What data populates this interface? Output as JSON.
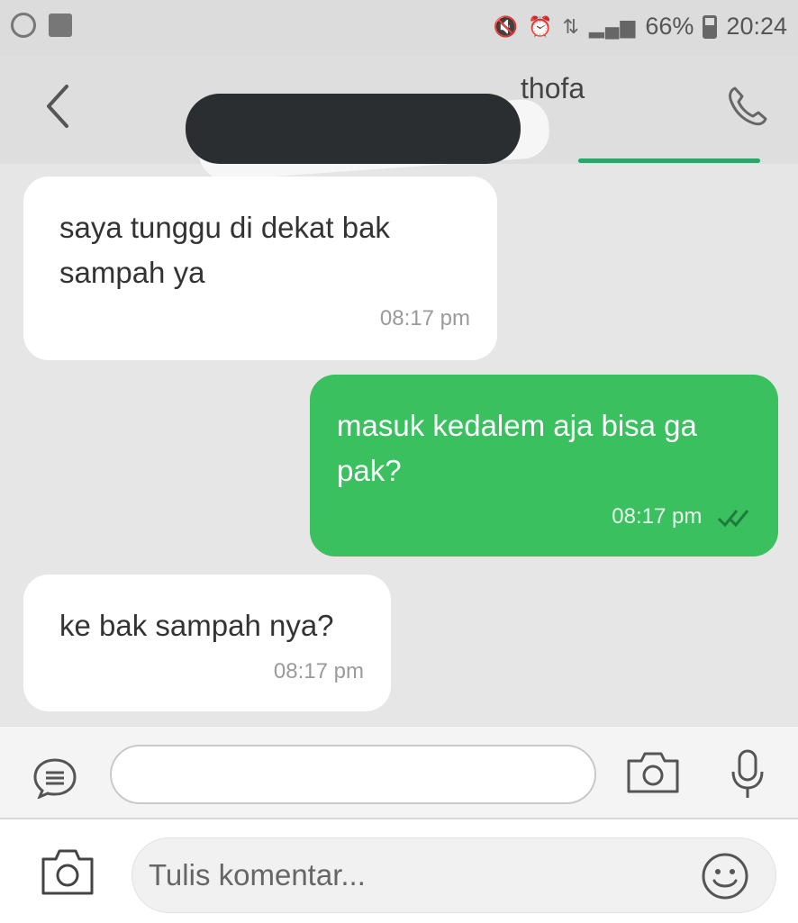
{
  "status_bar": {
    "left_icons": [
      "whatsapp-icon",
      "message-icon"
    ],
    "right_icons": [
      "mute-icon",
      "alarm-icon",
      "network-icon",
      "signal-icon",
      "battery-icon"
    ],
    "battery": "66%",
    "time": "20:24"
  },
  "header": {
    "contact_name_visible": "thofa",
    "back_icon": "chevron-left-icon",
    "call_icon": "phone-icon",
    "accent_color": "#2fa36a"
  },
  "messages": [
    {
      "direction": "incoming",
      "text": "saya tunggu di dekat bak sampah ya",
      "time": "08:17 pm"
    },
    {
      "direction": "outgoing",
      "text": "masuk kedalem aja bisa ga pak?",
      "time": "08:17 pm",
      "status_icon": "double-check-icon"
    },
    {
      "direction": "incoming",
      "text": "ke bak sampah nya?",
      "time": "08:17 pm"
    }
  ],
  "input_bar": {
    "value": "",
    "icons": [
      "menu-icon",
      "camera-icon",
      "microphone-icon"
    ]
  },
  "comment_bar": {
    "placeholder": "Tulis komentar...",
    "icons": [
      "camera-icon",
      "emoji-icon"
    ]
  },
  "colors": {
    "outgoing_bubble": "#3ac05f",
    "incoming_bubble": "#ffffff",
    "chat_background": "#e6e6e6"
  }
}
